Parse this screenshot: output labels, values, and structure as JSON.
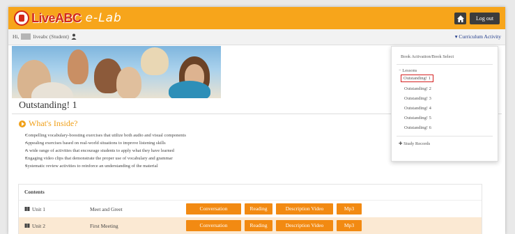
{
  "header": {
    "logo_live": "LiveABC",
    "logo_elab": "e-Lab",
    "logout_label": "Log out",
    "home_icon": "home-icon"
  },
  "userbar": {
    "greeting": "Hi,",
    "user_suffix": "liveabc (Student)",
    "curriculum_link": "▾ Curriculum Activity"
  },
  "book": {
    "title": "Outstanding! 1",
    "whats_inside": "What's Inside?",
    "bullets": [
      "Compelling vocabulary-boosting exercises that utilize both audio and visual components",
      "Appealing exercises based on real-world situations to improve listening skills",
      "A wide range of activities that encourage students to apply what they have learned",
      "Engaging video clips that demonstrate the proper use of vocabulary and grammar",
      "Systematic review activities to reinforce an understanding of the material"
    ]
  },
  "contents": {
    "heading": "Contents",
    "buttons": {
      "conversation": "Conversation",
      "reading": "Reading",
      "description_video": "Description Video",
      "mp3": "Mp3"
    },
    "units": [
      {
        "unit": "Unit 1",
        "title": "Meet and Greet"
      },
      {
        "unit": "Unit 2",
        "title": "First Meeting"
      }
    ]
  },
  "dropdown": {
    "activation": "Book Activation/Book Select",
    "lessons_label": "− Lessons",
    "lessons": [
      "Outstanding! 1",
      "Outstanding! 2",
      "Outstanding! 3",
      "Outstanding! 4",
      "Outstanding! 5",
      "Outstanding! 6"
    ],
    "selected_index": 0,
    "study_records": "✚ Study Records"
  },
  "colors": {
    "topbar": "#f7a51b",
    "button_orange": "#f28a12",
    "highlight_border": "#d42020",
    "link_blue": "#1f3a8a"
  }
}
